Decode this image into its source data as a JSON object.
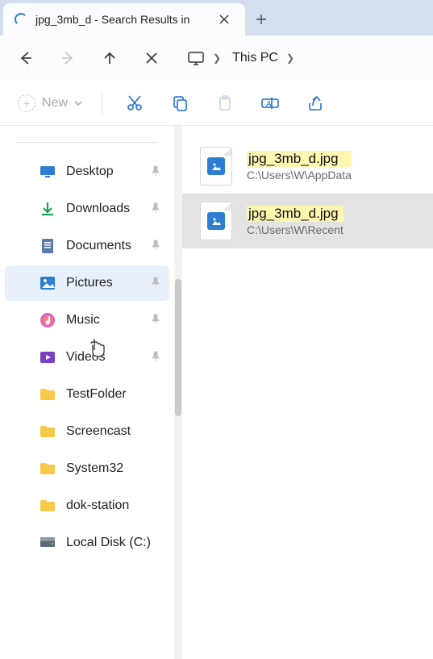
{
  "tab": {
    "title": "jpg_3mb_d - Search Results in"
  },
  "toolbar": {
    "new_label": "New"
  },
  "breadcrumb": {
    "root": "This PC"
  },
  "sidebar": {
    "items": [
      {
        "label": "Desktop",
        "icon": "desktop",
        "pinned": true
      },
      {
        "label": "Downloads",
        "icon": "download",
        "pinned": true
      },
      {
        "label": "Documents",
        "icon": "document",
        "pinned": true
      },
      {
        "label": "Pictures",
        "icon": "picture",
        "pinned": true,
        "hover": true
      },
      {
        "label": "Music",
        "icon": "music",
        "pinned": true
      },
      {
        "label": "Videos",
        "icon": "video",
        "pinned": true
      },
      {
        "label": "TestFolder",
        "icon": "folder",
        "pinned": false
      },
      {
        "label": "Screencast",
        "icon": "folder",
        "pinned": false
      },
      {
        "label": "System32",
        "icon": "folder",
        "pinned": false
      },
      {
        "label": "dok-station",
        "icon": "folder",
        "pinned": false
      },
      {
        "label": "Local Disk (C:)",
        "icon": "drive",
        "pinned": false
      }
    ]
  },
  "results": [
    {
      "name": "jpg_3mb_d.jpg",
      "path": "C:\\Users\\W\\AppData",
      "selected": false
    },
    {
      "name": "jpg_3mb_d.jpg",
      "path": "C:\\Users\\W\\Recent",
      "selected": true
    }
  ]
}
